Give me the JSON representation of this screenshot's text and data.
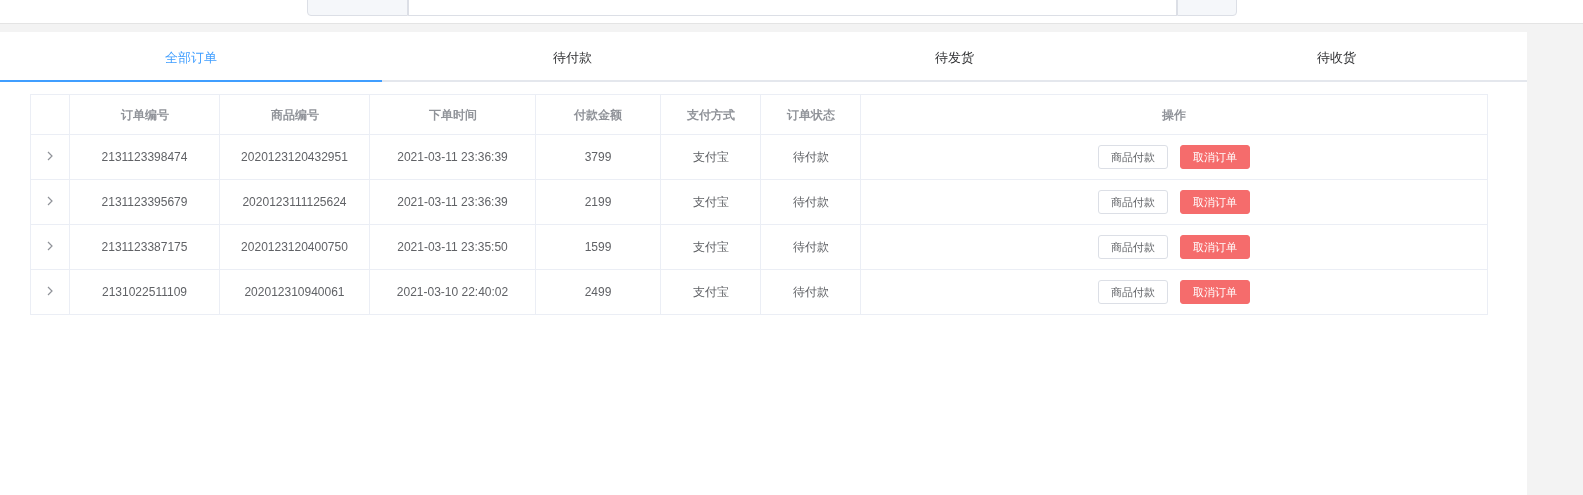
{
  "tabs": [
    {
      "label": "全部订单",
      "selected": true
    },
    {
      "label": "待付款",
      "selected": false
    },
    {
      "label": "待发货",
      "selected": false
    },
    {
      "label": "待收货",
      "selected": false
    }
  ],
  "table": {
    "columns": [
      "订单编号",
      "商品编号",
      "下单时间",
      "付款金额",
      "支付方式",
      "订单状态",
      "操作"
    ],
    "rows": [
      {
        "expanded": false,
        "cells": [
          "2131123398474",
          "2020123120432951",
          "2021-03-11 23:36:39",
          "3799",
          "支付宝",
          "待付款"
        ],
        "actions": [
          "商品付款",
          "取消订单"
        ]
      },
      {
        "expanded": false,
        "cells": [
          "2131123395679",
          "2020123111125624",
          "2021-03-11 23:36:39",
          "2199",
          "支付宝",
          "待付款"
        ],
        "actions": [
          "商品付款",
          "取消订单"
        ]
      },
      {
        "expanded": false,
        "cells": [
          "2131123387175",
          "2020123120400750",
          "2021-03-11 23:35:50",
          "1599",
          "支付宝",
          "待付款"
        ],
        "actions": [
          "商品付款",
          "取消订单"
        ]
      },
      {
        "expanded": false,
        "cells": [
          "2131022511109",
          "202012310940061",
          "2021-03-10 22:40:02",
          "2499",
          "支付宝",
          "待付款"
        ],
        "actions": [
          "商品付款",
          "取消订单"
        ]
      }
    ]
  }
}
